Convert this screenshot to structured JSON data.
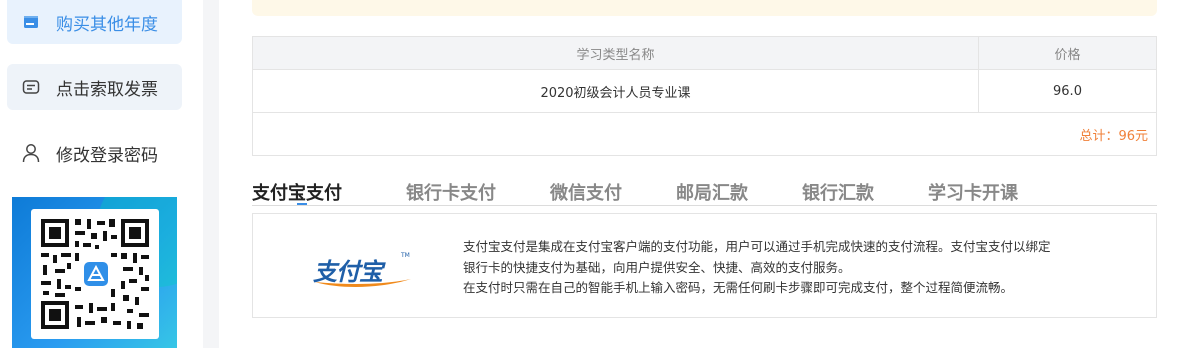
{
  "sidebar": {
    "items": [
      {
        "label": "购买其他年度",
        "icon": "card-icon"
      },
      {
        "label": "点击索取发票",
        "icon": "receipt-icon"
      },
      {
        "label": "修改登录密码",
        "icon": "user-icon"
      }
    ],
    "qr_icon": "qr-code-icon"
  },
  "table": {
    "headers": [
      "学习类型名称",
      "价格"
    ],
    "rows": [
      [
        "2020初级会计人员专业课",
        "96.0"
      ]
    ],
    "total": "总计：96元"
  },
  "tabs": [
    "支付宝支付",
    "银行卡支付",
    "微信支付",
    "邮局汇款",
    "银行汇款",
    "学习卡开课"
  ],
  "payment": {
    "logo_text": "支付宝",
    "logo_mark": "TM",
    "desc": [
      "支付宝支付是集成在支付宝客户端的支付功能，用户可以通过手机完成快速的支付流程。支付宝支付以绑定",
      "银行卡的快捷支付为基础，向用户提供安全、快捷、高效的支付服务。",
      "在支付时只需在自己的智能手机上输入密码，无需任何刷卡步骤即可完成支付，整个过程简便流畅。"
    ]
  },
  "colors": {
    "accent": "#3a8ee6",
    "total": "#f0813a",
    "alipay_blue": "#1f5fa8",
    "alipay_orange": "#f08a1c"
  }
}
